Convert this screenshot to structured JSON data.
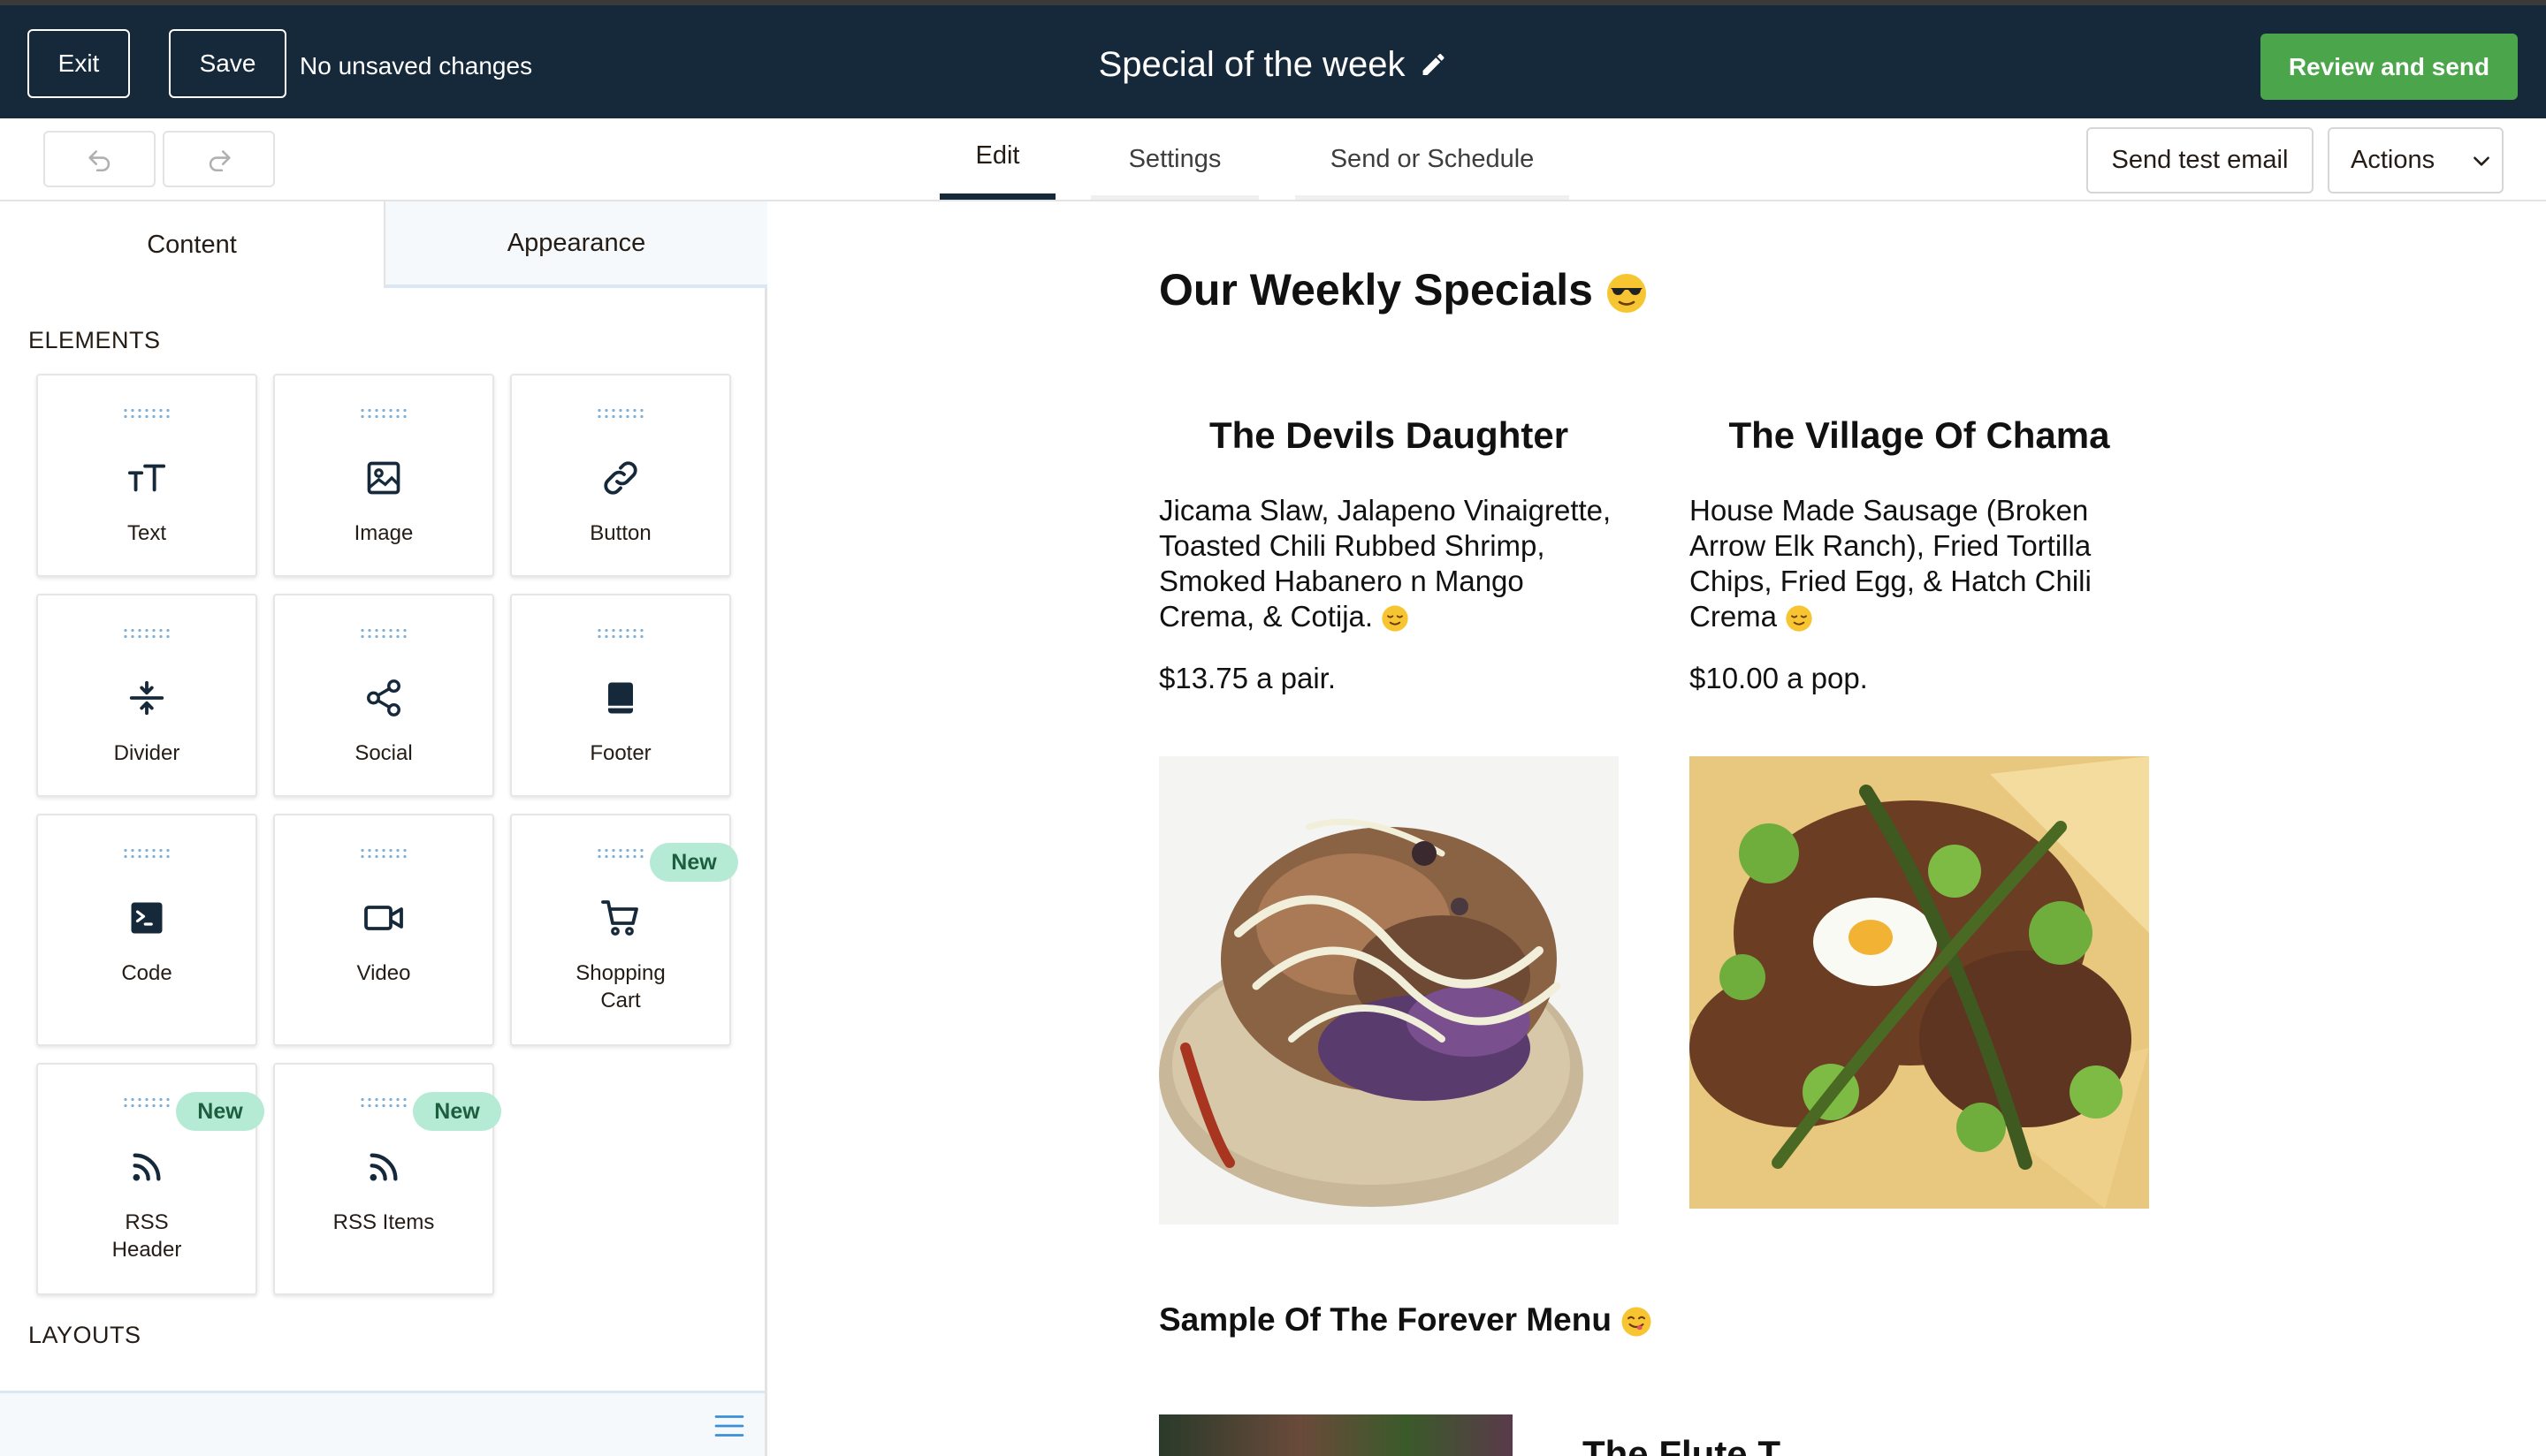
{
  "header": {
    "exit_label": "Exit",
    "save_label": "Save",
    "status_text": "No unsaved changes",
    "campaign_title": "Special of the week",
    "review_label": "Review and send"
  },
  "toolbar": {
    "tabs": [
      {
        "label": "Edit",
        "active": true
      },
      {
        "label": "Settings",
        "active": false
      },
      {
        "label": "Send or Schedule",
        "active": false
      }
    ],
    "send_test_label": "Send test email",
    "actions_label": "Actions"
  },
  "sidebar": {
    "tabs": [
      {
        "label": "Content",
        "active": true
      },
      {
        "label": "Appearance",
        "active": false
      }
    ],
    "elements_heading": "ELEMENTS",
    "elements": [
      {
        "label": "Text",
        "icon": "text-icon"
      },
      {
        "label": "Image",
        "icon": "image-icon"
      },
      {
        "label": "Button",
        "icon": "link-icon"
      },
      {
        "label": "Divider",
        "icon": "divider-icon"
      },
      {
        "label": "Social",
        "icon": "share-icon"
      },
      {
        "label": "Footer",
        "icon": "footer-icon"
      },
      {
        "label": "Code",
        "icon": "code-icon"
      },
      {
        "label": "Video",
        "icon": "video-icon"
      },
      {
        "label": "Shopping\nCart",
        "icon": "cart-icon",
        "badge": "New"
      },
      {
        "label": "RSS\nHeader",
        "icon": "rss-icon",
        "badge": "New"
      },
      {
        "label": "RSS Items",
        "icon": "rss-icon",
        "badge": "New"
      }
    ],
    "layouts_heading": "LAYOUTS"
  },
  "email": {
    "heading": "Our Weekly Specials",
    "heading_emoji": "sunglasses-emoji",
    "items": [
      {
        "title": "The Devils Daughter",
        "description": "Jicama Slaw, Jalapeno Vinaigrette, Toasted Chili Rubbed Shrimp, Smoked Habanero n Mango Crema, & Cotija.",
        "description_emoji": "relieved-emoji",
        "price": "$13.75 a pair."
      },
      {
        "title": "The Village Of Chama",
        "description": "House Made Sausage (Broken Arrow Elk Ranch), Fried Tortilla Chips, Fried Egg, & Hatch Chili Crema",
        "description_emoji": "relieved-emoji",
        "price": "$10.00 a pop."
      }
    ],
    "subheading": "Sample Of The Forever Menu",
    "subheading_emoji": "yum-emoji",
    "partial_title": "The Flute T"
  },
  "colors": {
    "header_bg": "#16293b",
    "primary_green": "#4ba54a",
    "badge_bg": "#b5ebd5",
    "badge_text": "#1d5e3f",
    "icon_navy": "#16293b"
  }
}
